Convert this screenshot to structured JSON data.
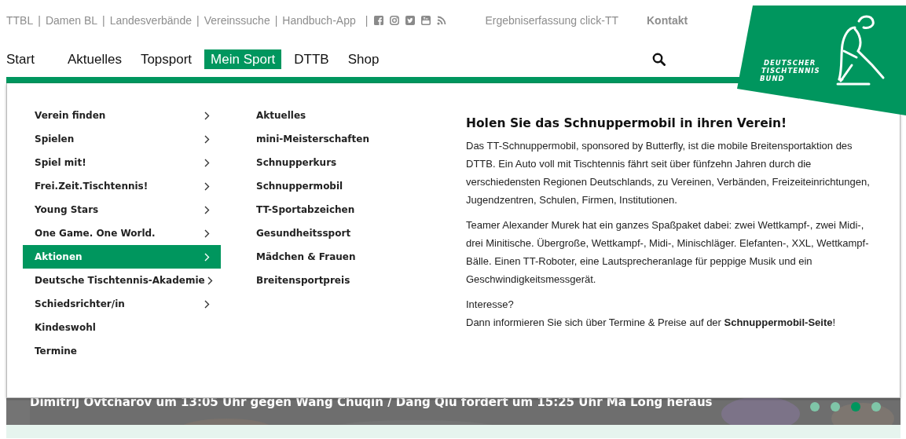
{
  "separator": "|",
  "top_links": [
    {
      "label": "TTBL"
    },
    {
      "label": "Damen BL"
    },
    {
      "label": "Landesverbände"
    },
    {
      "label": "Vereinssuche"
    },
    {
      "label": "Handbuch-App"
    }
  ],
  "social": [
    {
      "kind": "facebook"
    },
    {
      "kind": "instagram"
    },
    {
      "kind": "twitter"
    },
    {
      "kind": "youtube"
    },
    {
      "kind": "rss"
    }
  ],
  "extra_links": [
    {
      "label": "Ergebniserfassung click-TT",
      "bold": false
    },
    {
      "label": "Kontakt",
      "bold": true
    }
  ],
  "logo": {
    "lines": [
      "DEUTSCHER",
      "TISCHTENNIS",
      "BUND"
    ]
  },
  "nav": [
    {
      "label": "Start",
      "selected": false
    },
    {
      "label": "Aktuelles",
      "selected": false
    },
    {
      "label": "Topsport",
      "selected": false
    },
    {
      "label": "Mein Sport",
      "selected": true
    },
    {
      "label": "DTTB",
      "selected": false
    },
    {
      "label": "Shop",
      "selected": false
    }
  ],
  "menu": {
    "column_1": [
      {
        "label": "Verein finden",
        "has_submenu": true,
        "selected": false
      },
      {
        "label": "Spielen",
        "has_submenu": true,
        "selected": false
      },
      {
        "label": "Spiel mit!",
        "has_submenu": true,
        "selected": false
      },
      {
        "label": "Frei.Zeit.Tischtennis!",
        "has_submenu": true,
        "selected": false
      },
      {
        "label": "Young Stars",
        "has_submenu": true,
        "selected": false
      },
      {
        "label": "One Game. One World.",
        "has_submenu": true,
        "selected": false
      },
      {
        "label": "Aktionen",
        "has_submenu": true,
        "selected": true
      },
      {
        "label": "Deutsche Tischtennis-Akademie",
        "has_submenu": true,
        "selected": false
      },
      {
        "label": "Schiedsrichter/in",
        "has_submenu": true,
        "selected": false
      },
      {
        "label": "Kindeswohl",
        "has_submenu": false,
        "selected": false
      },
      {
        "label": "Termine",
        "has_submenu": false,
        "selected": false
      }
    ],
    "column_2": [
      {
        "label": "Aktuelles"
      },
      {
        "label": "mini-Meisterschaften"
      },
      {
        "label": "Schnupperkurs"
      },
      {
        "label": "Schnuppermobil"
      },
      {
        "label": "TT-Sportabzeichen"
      },
      {
        "label": "Gesundheitssport"
      },
      {
        "label": "Mädchen & Frauen"
      },
      {
        "label": "Breitensportpreis"
      }
    ],
    "teaser": {
      "title": "Holen Sie das Schnuppermobil in ihren Verein!",
      "paragraphs": [
        "Das TT-Schnuppermobil, sponsored by Butterfly, ist die mobile Breitensportaktion des DTTB. Ein Auto voll mit Tischtennis fährt seit über fünfzehn Jahren durch die verschiedensten Regionen Deutschlands, zu Vereinen, Verbänden, Freizeiteinrichtungen, Jugendzentren, Schulen, Firmen, Institutionen.",
        "Teamer Alexander Murek hat ein ganzes Spaßpaket dabei: zwei Wettkampf-, zwei Midi-, drei Minitische. Übergroße, Wettkampf-, Midi-, Minischläger. Elefanten-, XXL, Wettkampf-Bälle. Einen TT-Roboter, eine Lautsprecheranlage für peppige Musik und ein Geschwindigkeitsmessgerät."
      ],
      "closing": "Interesse?",
      "link_sentence": "Dann informieren Sie sich über Termine & Preise auf der **Schnuppermobil-Seite**!"
    }
  },
  "slider": {
    "caption": "Dimitrij Ovtcharov um 13:05 Uhr gegen Wang Chuqin / Dang Qiu fordert um 15:25 Uhr Ma Long heraus",
    "dots": [
      {
        "selected": false
      },
      {
        "selected": false
      },
      {
        "selected": true
      },
      {
        "selected": false
      }
    ]
  }
}
